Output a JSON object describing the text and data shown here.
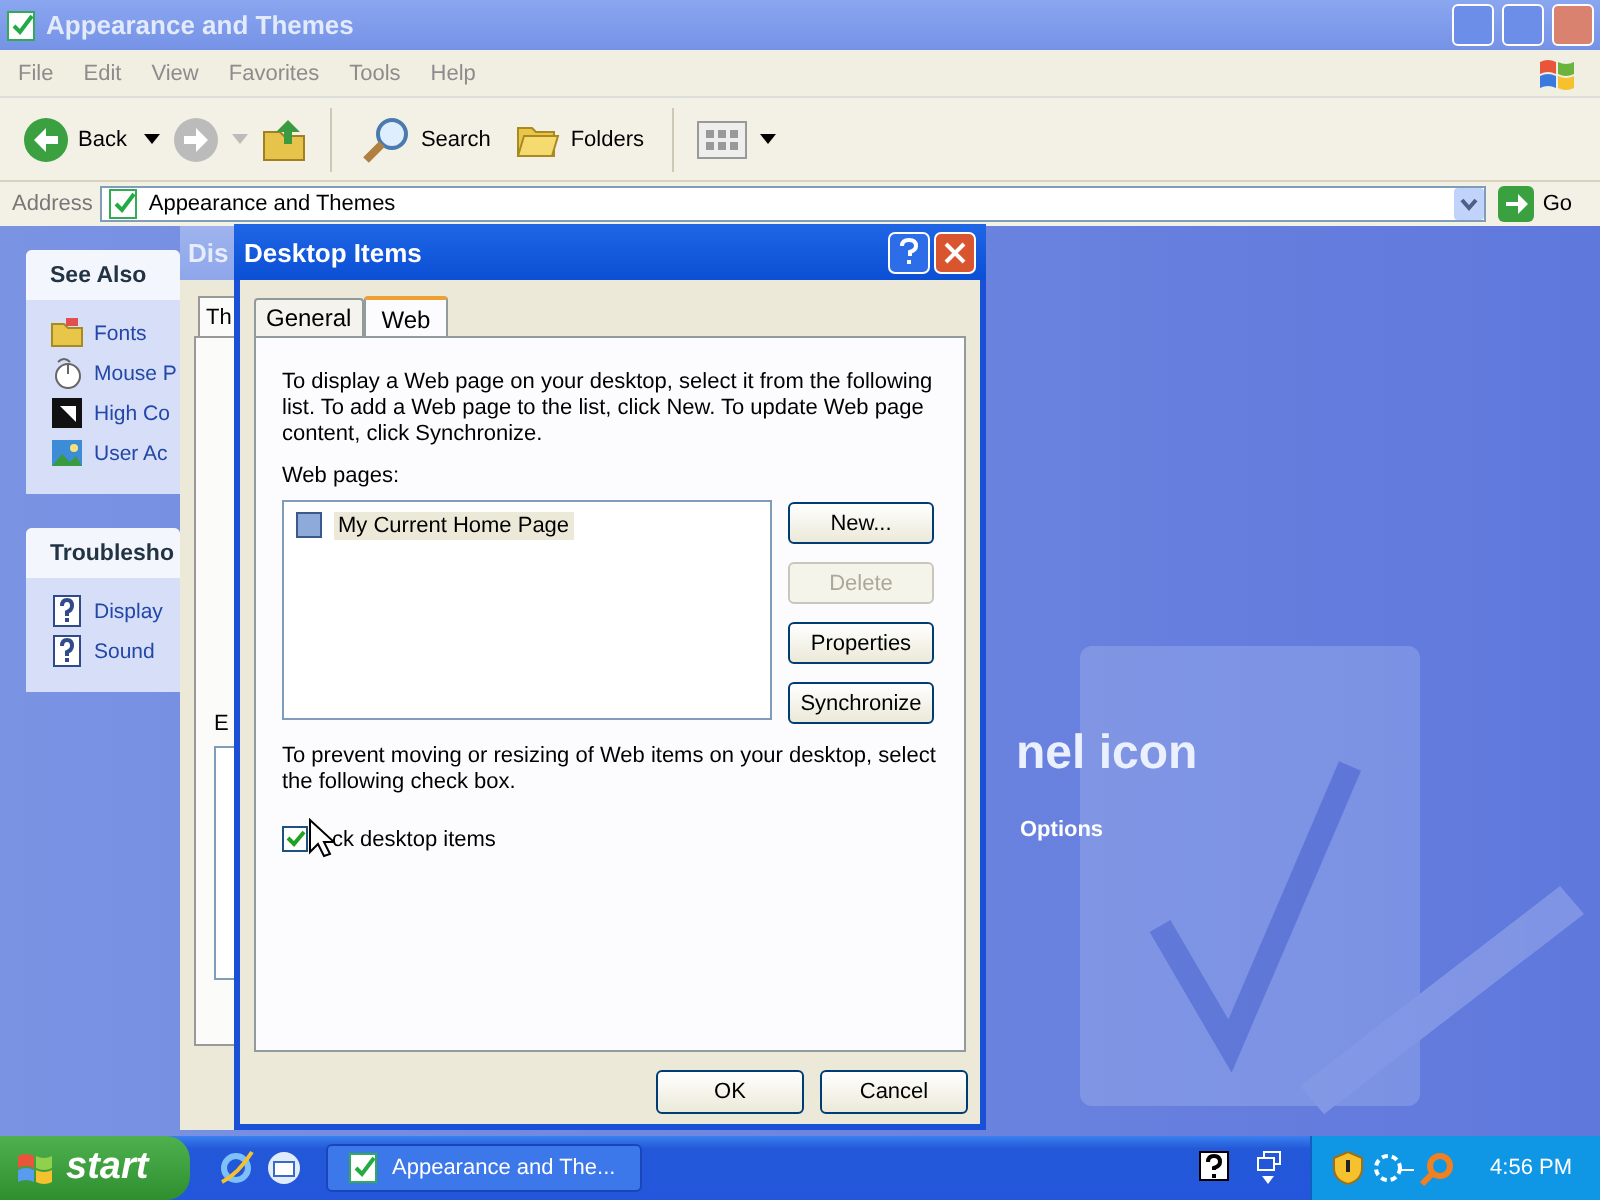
{
  "window": {
    "title": "Appearance and Themes"
  },
  "menu": [
    "File",
    "Edit",
    "View",
    "Favorites",
    "Tools",
    "Help"
  ],
  "toolbar": {
    "back": "Back",
    "search": "Search",
    "folders": "Folders"
  },
  "address": {
    "label": "Address",
    "value": "Appearance and Themes",
    "go": "Go"
  },
  "sidebar": {
    "panels": [
      {
        "title": "See Also",
        "items": [
          {
            "label": "Fonts",
            "kind": "folder"
          },
          {
            "label": "Mouse P",
            "kind": "mouse"
          },
          {
            "label": "High Co",
            "kind": "contrast"
          },
          {
            "label": "User Ac",
            "kind": "user"
          }
        ]
      },
      {
        "title": "Troublesho",
        "items": [
          {
            "label": "Display",
            "kind": "help"
          },
          {
            "label": "Sound",
            "kind": "help"
          }
        ]
      }
    ]
  },
  "content": {
    "heading": "nel icon",
    "link": "Options"
  },
  "background_window": {
    "title": "Dis",
    "tab": "Th",
    "label": "E"
  },
  "dialog": {
    "title": "Desktop Items",
    "tabs": [
      {
        "label": "General",
        "selected": false
      },
      {
        "label": "Web",
        "selected": true
      }
    ],
    "intro": "To display a Web page on your desktop, select it from the following list. To add a Web page to the list, click New.  To update Web page content, click Synchronize.",
    "list_label": "Web pages:",
    "web_pages": [
      {
        "label": "My Current Home Page",
        "checked": false,
        "selected": true
      }
    ],
    "buttons": [
      {
        "label": "New...",
        "disabled": false
      },
      {
        "label": "Delete",
        "disabled": true
      },
      {
        "label": "Properties",
        "disabled": false
      },
      {
        "label": "Synchronize",
        "disabled": false
      }
    ],
    "lock_text": "To prevent moving or resizing of Web items on your desktop, select the following check box.",
    "lock_checkbox": {
      "label": "ck desktop items",
      "checked": true
    },
    "footer_buttons": [
      "OK",
      "Cancel"
    ]
  },
  "taskbar": {
    "start": "start",
    "task": "Appearance and The...",
    "clock": "4:56 PM"
  }
}
